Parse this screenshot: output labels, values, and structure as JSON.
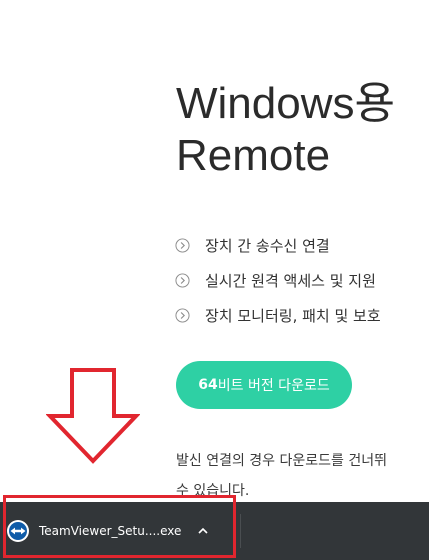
{
  "hero": {
    "title_line1": "Windows용",
    "title_line2": "Remote"
  },
  "features": [
    "장치 간 송수신 연결",
    "실시간 원격 액세스 및 지원",
    "장치 모니터링, 패치 및 보호"
  ],
  "download_button": {
    "bits": "64",
    "label": "비트 버전 다운로드",
    "color": "#2ed0a4"
  },
  "note": {
    "line1": "발신 연결의 경우 다운로드를 건너뛰",
    "line2": "수 있습니다."
  },
  "download_shelf": {
    "file_name": "TeamViewer_Setu....exe",
    "icon": "teamviewer-icon",
    "caret_icon": "chevron-up-icon",
    "background": "#323639"
  },
  "annotation": {
    "color": "#e1262f",
    "arrow_icon": "arrow-down-icon"
  }
}
